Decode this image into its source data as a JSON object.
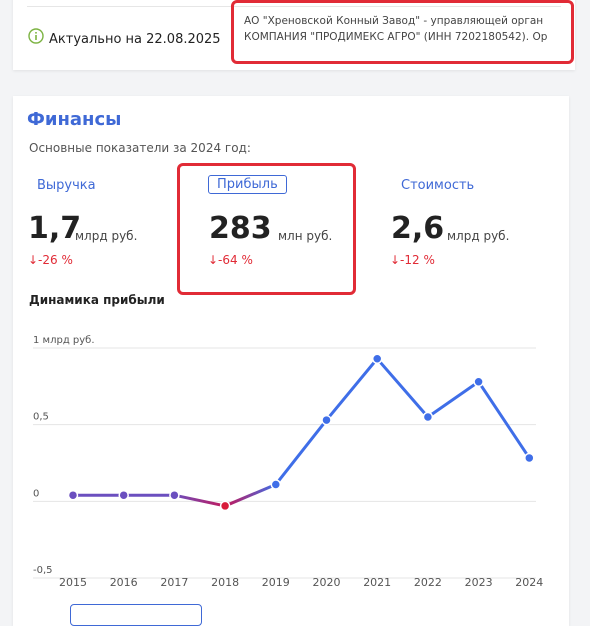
{
  "top": {
    "updated": "Актуально на 22.08.2025",
    "manager_line1": "АО \"Хреновской Конный Завод\" - управляющей орган",
    "manager_line2": "КОМПАНИЯ \"ПРОДИМЕКС АГРО\" (ИНН 7202180542). Ор"
  },
  "finance": {
    "title": "Финансы",
    "subtitle": "Основные показатели за 2024 год:",
    "metrics": [
      {
        "label": "Выручка",
        "value": "1,7",
        "unit": "млрд руб.",
        "change": "↓-26 %"
      },
      {
        "label": "Прибыль",
        "value": "283",
        "unit": "млн руб.",
        "change": "↓-64 %"
      },
      {
        "label": "Стоимость",
        "value": "2,6",
        "unit": "млрд руб.",
        "change": "↓-12 %"
      }
    ],
    "chart_title": "Динамика прибыли"
  },
  "colors": {
    "accent": "#3f69d6",
    "negative": "#e12b36",
    "line_blue": "#3f6ee8",
    "line_purple": "#6b4fbf"
  },
  "chart_data": {
    "type": "line",
    "title": "Динамика прибыли",
    "x": [
      "2015",
      "2016",
      "2017",
      "2018",
      "2019",
      "2020",
      "2021",
      "2022",
      "2023",
      "2024"
    ],
    "series": [
      {
        "values": [
          0.04,
          0.04,
          0.04,
          -0.03,
          0.11,
          0.53,
          0.93,
          0.55,
          0.78,
          0.283
        ]
      }
    ],
    "yticks": [
      "1 млрд руб.",
      "0,5",
      "0",
      "-0,5"
    ],
    "ytick_values": [
      1,
      0.5,
      0,
      -0.5
    ],
    "ylim": [
      -0.5,
      1
    ],
    "grid": true
  }
}
